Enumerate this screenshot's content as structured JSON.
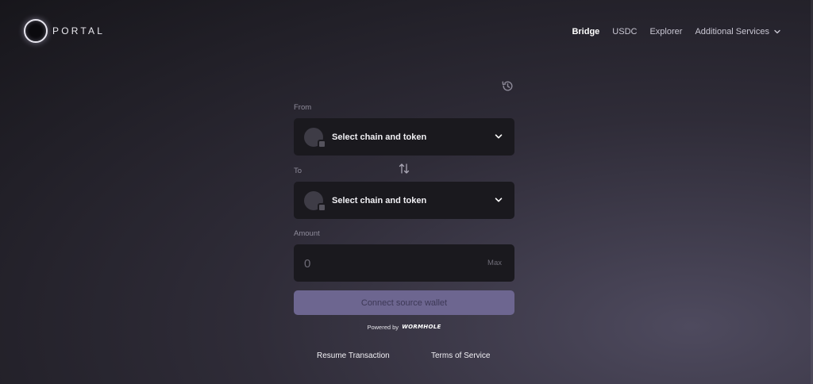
{
  "brand": {
    "name": "PORTAL"
  },
  "nav": {
    "items": [
      {
        "label": "Bridge",
        "active": true
      },
      {
        "label": "USDC",
        "active": false
      },
      {
        "label": "Explorer",
        "active": false
      }
    ],
    "more_label": "Additional Services"
  },
  "bridge": {
    "from_label": "From",
    "to_label": "To",
    "from_selector": "Select chain and token",
    "to_selector": "Select chain and token",
    "amount_label": "Amount",
    "amount_placeholder": "0",
    "max_label": "Max",
    "connect_label": "Connect source wallet",
    "powered_by": "Powered by",
    "powered_brand": "WORMHOLE"
  },
  "footer": {
    "resume": "Resume Transaction",
    "terms": "Terms of Service"
  },
  "colors": {
    "accent": "#6d6690",
    "card": "#1a191e",
    "label": "#8e8b9a"
  },
  "icons": [
    "portal-logo-icon",
    "chevron-down-icon",
    "history-icon",
    "swap-arrows-icon"
  ]
}
